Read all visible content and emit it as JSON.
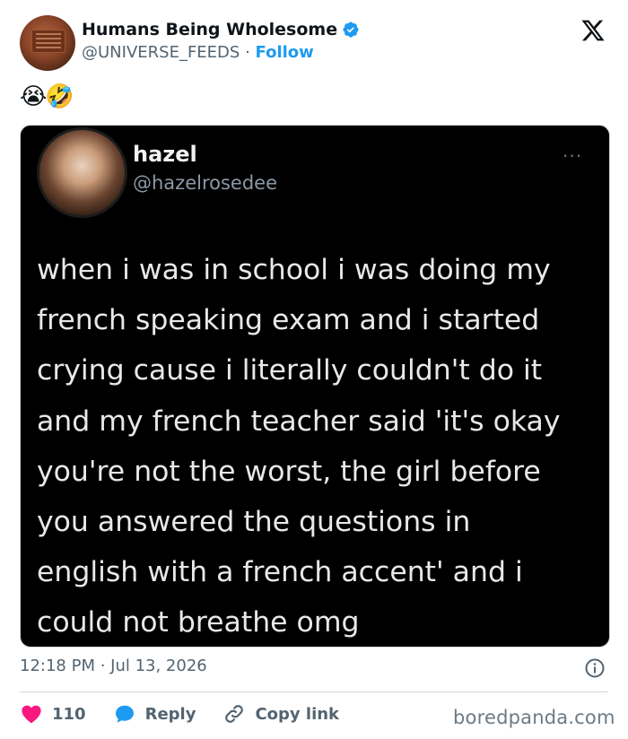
{
  "post": {
    "author_name": "Humans Being Wholesome",
    "handle": "@UNIVERSE_FEEDS",
    "separator": "·",
    "follow_label": "Follow",
    "text": "😭🤣",
    "timestamp": "12:18 PM · Jul 13, 2026"
  },
  "embedded": {
    "name": "hazel",
    "handle": "@hazelrosedee",
    "more": "···",
    "text": "when i was in school i was doing my\nfrench speaking exam and i started\ncrying cause i literally couldn't do it\nand my french teacher said 'it's okay\nyou're not the worst, the girl before\nyou answered the questions in\nenglish with a french accent' and i\ncould not breathe omg"
  },
  "actions": {
    "likes": "110",
    "reply_label": "Reply",
    "copy_link_label": "Copy link"
  },
  "watermark": "boredpanda.com",
  "colors": {
    "accent": "#1d9bf0",
    "like": "#f91880",
    "reply": "#1d9bf0",
    "text_secondary": "#536471"
  },
  "icons": [
    "verified-badge-icon",
    "x-logo-icon",
    "info-icon",
    "heart-icon",
    "reply-bubble-icon",
    "link-icon"
  ]
}
